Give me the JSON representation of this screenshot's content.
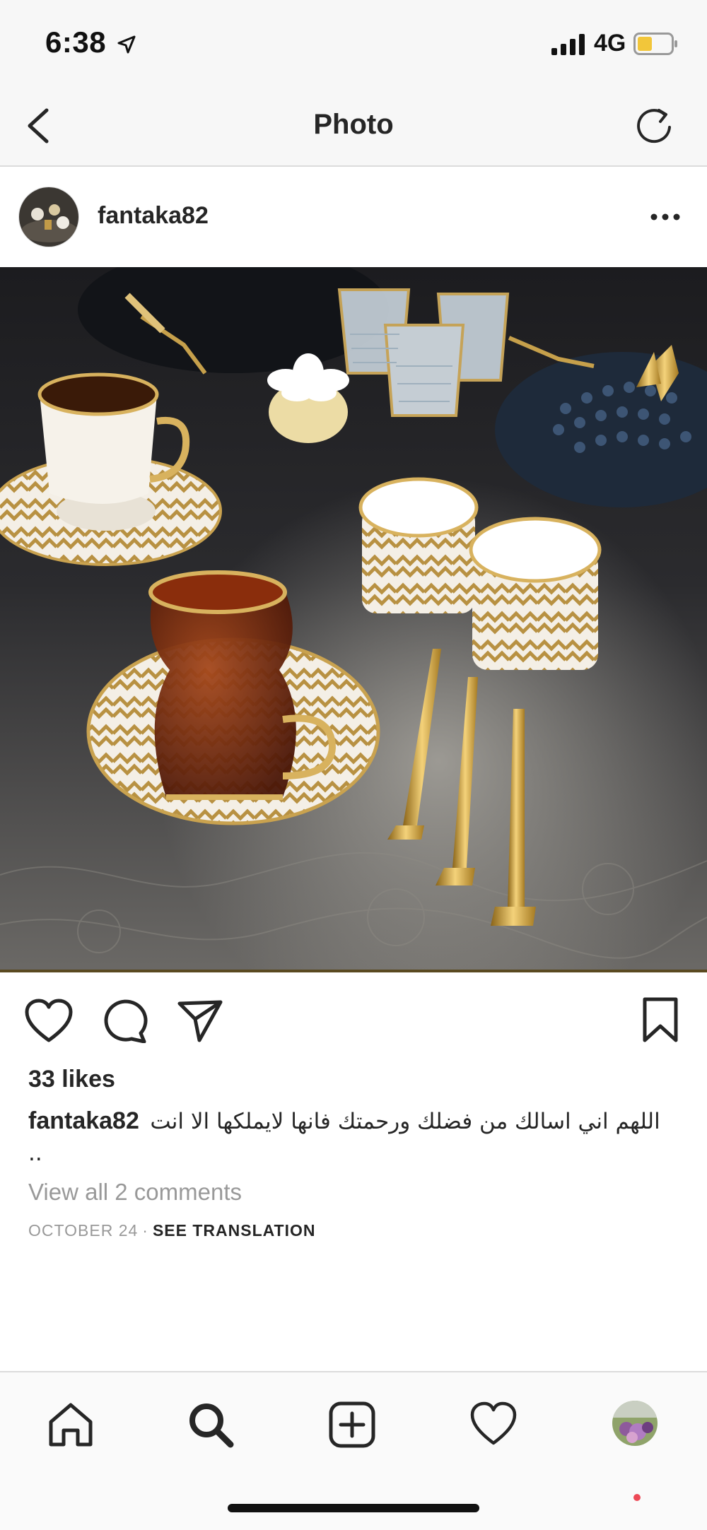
{
  "status_bar": {
    "time": "6:38",
    "network": "4G",
    "battery_level": 0.45,
    "battery_color": "#f2c63a"
  },
  "nav": {
    "title": "Photo",
    "back_icon": "chevron-left-icon",
    "refresh_icon": "refresh-icon"
  },
  "post": {
    "username": "fantaka82",
    "more_icon": "ellipsis-icon",
    "image_subject": "Turkish tea glass, coffee cups, gold spoons and crystal glasses on a dark tray",
    "likes": "33 likes",
    "caption_user": "fantaka82",
    "caption_text": "اللهم اني اسالك من فضلك ورحمتك فانها لايملكها الا انت ..",
    "view_comments": "View all 2 comments",
    "date": "OCTOBER 24",
    "separator": "·",
    "see_translation": "SEE TRANSLATION"
  },
  "actions": {
    "like_icon": "heart-icon",
    "comment_icon": "comment-icon",
    "share_icon": "paper-plane-icon",
    "save_icon": "bookmark-icon"
  },
  "tab_bar": {
    "items": [
      "home-icon",
      "search-icon",
      "new-post-icon",
      "activity-heart-icon",
      "profile-avatar"
    ],
    "notification_color": "#ed4956"
  }
}
